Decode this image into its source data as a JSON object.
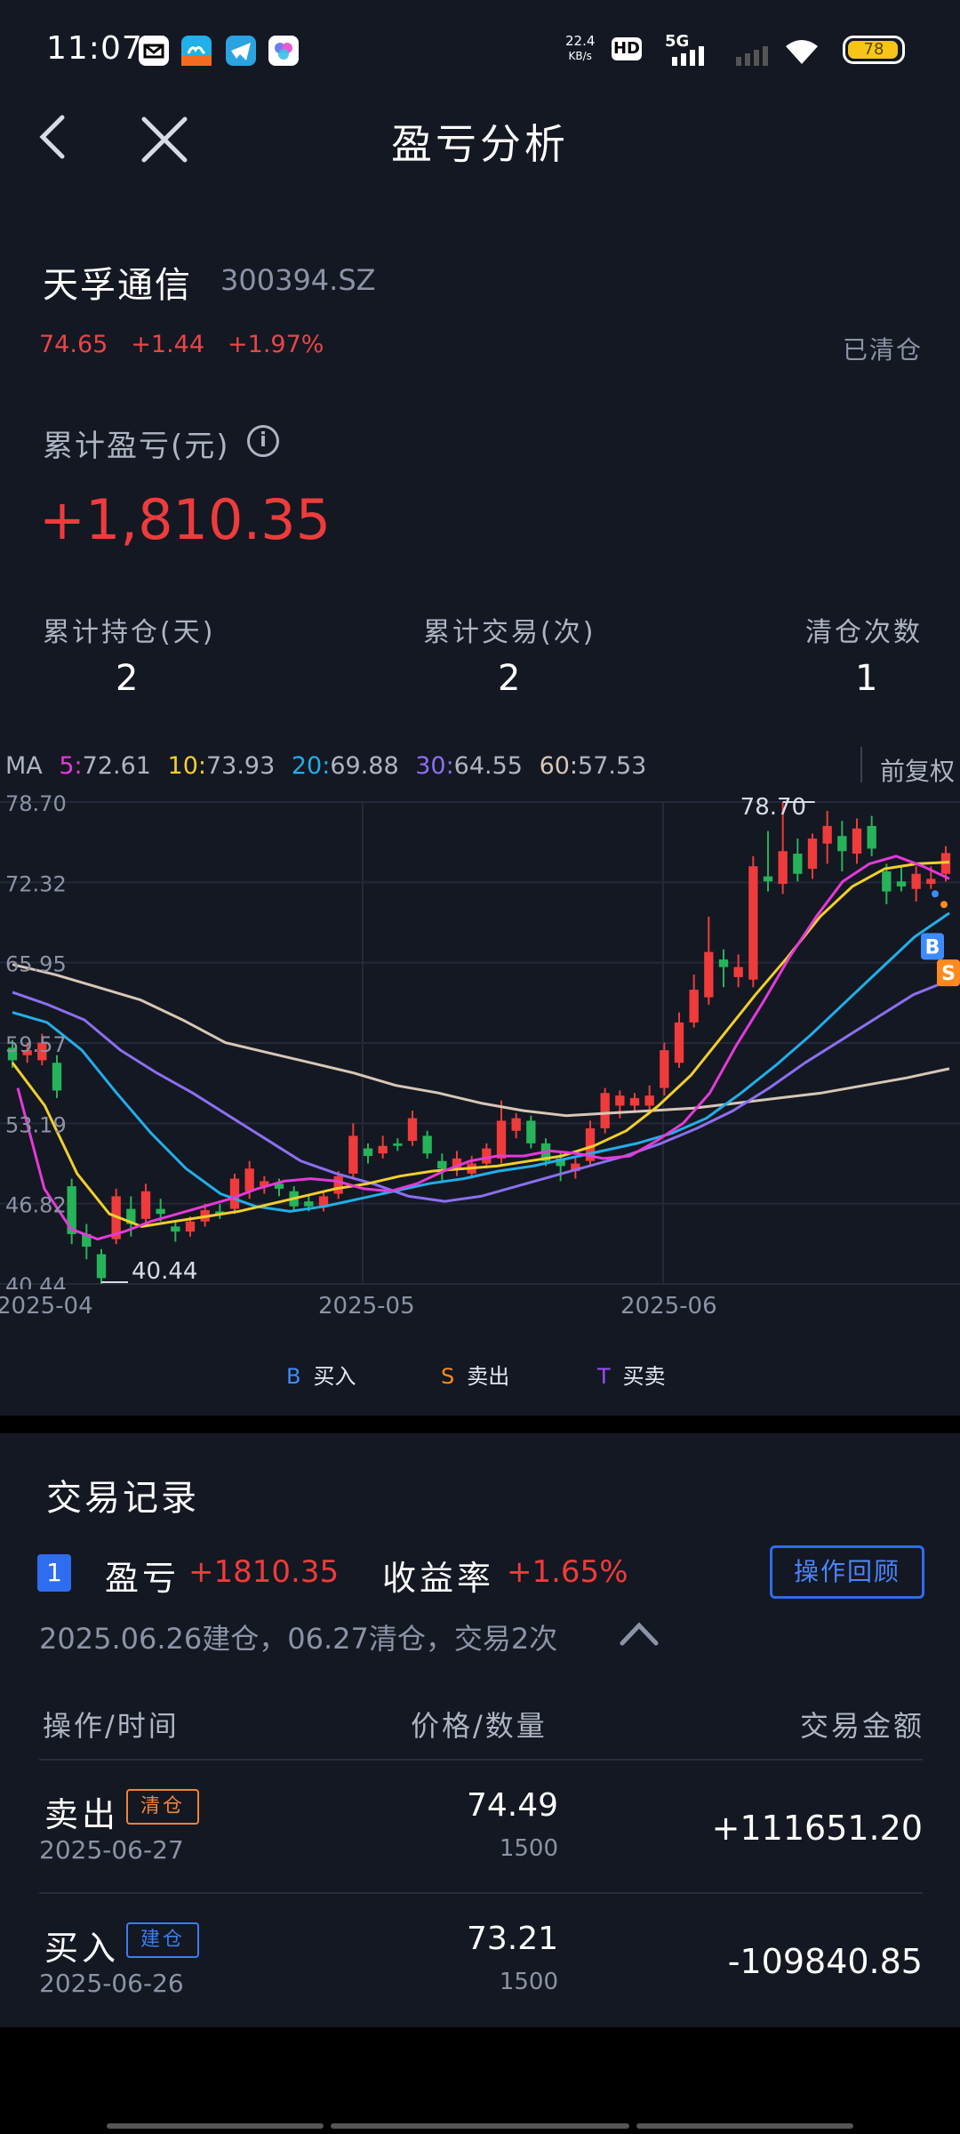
{
  "status_bar": {
    "time": "11:07",
    "net_speed_value": "22.4",
    "net_speed_unit": "KB/s",
    "hd": "HD",
    "network": "5G",
    "battery": "78",
    "app_icons": [
      "mail-app-icon",
      "camel-app-icon",
      "telegram-app-icon",
      "bubble-app-icon"
    ]
  },
  "header": {
    "title": "盈亏分析"
  },
  "stock": {
    "name": "天孚通信",
    "code": "300394.SZ",
    "price": "74.65",
    "change": "+1.44",
    "change_pct": "+1.97%",
    "status": "已清仓"
  },
  "cumulative": {
    "label": "累计盈亏(元)",
    "value": "+1,810.35"
  },
  "stats": [
    {
      "label": "累计持仓(天)",
      "value": "2"
    },
    {
      "label": "累计交易(次)",
      "value": "2"
    },
    {
      "label": "清仓次数",
      "value": "1"
    }
  ],
  "ma": {
    "prefix": "MA",
    "items": [
      {
        "key": "5:",
        "value": "72.61",
        "color": "#e43ad8"
      },
      {
        "key": "10:",
        "value": "73.93",
        "color": "#f1cf2c"
      },
      {
        "key": "20:",
        "value": "69.88",
        "color": "#22aee8"
      },
      {
        "key": "30:",
        "value": "64.55",
        "color": "#8b6ff0"
      },
      {
        "key": "60:",
        "value": "57.53",
        "color": "#d7c7b6"
      }
    ],
    "adjust": "前复权"
  },
  "chart_data": {
    "type": "candlestick",
    "y_ticks": [
      "78.70",
      "72.32",
      "65.95",
      "59.57",
      "53.19",
      "46.82",
      "40.44"
    ],
    "ylim": [
      40.44,
      78.7
    ],
    "x_ticks": [
      "2025-04",
      "2025-05",
      "2025-06"
    ],
    "high_label": "78.70",
    "low_label": "40.44",
    "candles": [
      {
        "o": 59.2,
        "c": 58.2,
        "h": 59.8,
        "l": 57.6
      },
      {
        "o": 58.6,
        "c": 59.0,
        "h": 59.6,
        "l": 58.0
      },
      {
        "o": 58.2,
        "c": 59.6,
        "h": 60.3,
        "l": 57.8
      },
      {
        "o": 58.0,
        "c": 55.8,
        "h": 58.6,
        "l": 55.2
      },
      {
        "o": 48.2,
        "c": 44.4,
        "h": 48.8,
        "l": 43.6
      },
      {
        "o": 44.4,
        "c": 43.4,
        "h": 45.2,
        "l": 42.4
      },
      {
        "o": 42.8,
        "c": 40.9,
        "h": 43.2,
        "l": 40.44
      },
      {
        "o": 44.0,
        "c": 47.4,
        "h": 48.0,
        "l": 43.6
      },
      {
        "o": 46.4,
        "c": 45.2,
        "h": 47.4,
        "l": 44.2
      },
      {
        "o": 45.6,
        "c": 47.8,
        "h": 48.4,
        "l": 45.0
      },
      {
        "o": 46.4,
        "c": 46.0,
        "h": 47.2,
        "l": 45.4
      },
      {
        "o": 45.0,
        "c": 44.6,
        "h": 45.4,
        "l": 43.8
      },
      {
        "o": 44.6,
        "c": 45.4,
        "h": 45.8,
        "l": 44.2
      },
      {
        "o": 45.4,
        "c": 46.3,
        "h": 46.8,
        "l": 45.0
      },
      {
        "o": 46.2,
        "c": 46.0,
        "h": 46.8,
        "l": 45.6
      },
      {
        "o": 46.4,
        "c": 48.8,
        "h": 49.2,
        "l": 46.0
      },
      {
        "o": 47.8,
        "c": 49.6,
        "h": 50.2,
        "l": 47.2
      },
      {
        "o": 48.2,
        "c": 48.6,
        "h": 49.0,
        "l": 47.6
      },
      {
        "o": 48.4,
        "c": 48.0,
        "h": 48.8,
        "l": 47.4
      },
      {
        "o": 47.8,
        "c": 46.6,
        "h": 48.2,
        "l": 46.2
      },
      {
        "o": 47.0,
        "c": 46.6,
        "h": 47.4,
        "l": 46.2
      },
      {
        "o": 46.6,
        "c": 47.4,
        "h": 47.8,
        "l": 46.2
      },
      {
        "o": 47.6,
        "c": 49.0,
        "h": 49.4,
        "l": 47.2
      },
      {
        "o": 49.2,
        "c": 52.2,
        "h": 53.2,
        "l": 48.8
      },
      {
        "o": 51.2,
        "c": 50.6,
        "h": 51.6,
        "l": 50.0
      },
      {
        "o": 50.8,
        "c": 51.4,
        "h": 52.2,
        "l": 50.4
      },
      {
        "o": 51.6,
        "c": 51.4,
        "h": 52.0,
        "l": 51.0
      },
      {
        "o": 51.8,
        "c": 53.6,
        "h": 54.2,
        "l": 51.4
      },
      {
        "o": 52.2,
        "c": 50.8,
        "h": 52.6,
        "l": 50.4
      },
      {
        "o": 50.2,
        "c": 49.6,
        "h": 50.8,
        "l": 48.6
      },
      {
        "o": 49.6,
        "c": 50.4,
        "h": 51.0,
        "l": 49.0
      },
      {
        "o": 49.2,
        "c": 50.0,
        "h": 50.6,
        "l": 48.8
      },
      {
        "o": 50.0,
        "c": 51.2,
        "h": 51.6,
        "l": 49.6
      },
      {
        "o": 50.4,
        "c": 53.4,
        "h": 55.0,
        "l": 50.0
      },
      {
        "o": 52.6,
        "c": 53.6,
        "h": 54.0,
        "l": 52.0
      },
      {
        "o": 53.4,
        "c": 51.6,
        "h": 53.8,
        "l": 51.2
      },
      {
        "o": 51.6,
        "c": 50.2,
        "h": 52.0,
        "l": 49.8
      },
      {
        "o": 50.4,
        "c": 49.8,
        "h": 51.0,
        "l": 48.6
      },
      {
        "o": 49.4,
        "c": 50.0,
        "h": 50.6,
        "l": 48.8
      },
      {
        "o": 50.2,
        "c": 52.8,
        "h": 53.4,
        "l": 49.8
      },
      {
        "o": 52.8,
        "c": 55.6,
        "h": 56.0,
        "l": 52.4
      },
      {
        "o": 54.6,
        "c": 55.4,
        "h": 55.8,
        "l": 53.6
      },
      {
        "o": 54.6,
        "c": 55.2,
        "h": 55.6,
        "l": 54.2
      },
      {
        "o": 54.6,
        "c": 55.4,
        "h": 56.2,
        "l": 54.2
      },
      {
        "o": 56.0,
        "c": 59.0,
        "h": 59.6,
        "l": 55.4
      },
      {
        "o": 58.0,
        "c": 61.2,
        "h": 62.0,
        "l": 57.6
      },
      {
        "o": 61.2,
        "c": 63.8,
        "h": 65.0,
        "l": 60.8
      },
      {
        "o": 63.2,
        "c": 66.8,
        "h": 69.6,
        "l": 62.6
      },
      {
        "o": 66.2,
        "c": 65.6,
        "h": 67.0,
        "l": 64.0
      },
      {
        "o": 64.8,
        "c": 65.6,
        "h": 66.6,
        "l": 64.0
      },
      {
        "o": 64.6,
        "c": 73.6,
        "h": 74.4,
        "l": 64.0
      },
      {
        "o": 72.8,
        "c": 72.4,
        "h": 76.4,
        "l": 71.6
      },
      {
        "o": 72.2,
        "c": 74.8,
        "h": 78.7,
        "l": 71.4
      },
      {
        "o": 74.6,
        "c": 73.0,
        "h": 75.8,
        "l": 72.4
      },
      {
        "o": 73.4,
        "c": 75.8,
        "h": 76.2,
        "l": 72.6
      },
      {
        "o": 75.4,
        "c": 76.8,
        "h": 78.0,
        "l": 73.8
      },
      {
        "o": 76.0,
        "c": 74.8,
        "h": 77.2,
        "l": 73.2
      },
      {
        "o": 74.6,
        "c": 76.6,
        "h": 77.4,
        "l": 73.8
      },
      {
        "o": 76.8,
        "c": 75.0,
        "h": 77.6,
        "l": 74.4
      },
      {
        "o": 73.2,
        "c": 71.6,
        "h": 73.8,
        "l": 70.6
      },
      {
        "o": 72.4,
        "c": 72.0,
        "h": 73.6,
        "l": 71.6
      },
      {
        "o": 71.8,
        "c": 73.0,
        "h": 73.6,
        "l": 70.8
      },
      {
        "o": 72.2,
        "c": 72.6,
        "h": 73.6,
        "l": 71.8
      },
      {
        "o": 73.0,
        "c": 74.65,
        "h": 75.2,
        "l": 72.4
      }
    ],
    "ma5": [
      56.0,
      48.0,
      44.8,
      44.0,
      44.6,
      45.4,
      46.0,
      46.6,
      47.2,
      48.0,
      48.6,
      48.8,
      48.6,
      48.0,
      47.8,
      48.4,
      49.4,
      50.2,
      50.6,
      50.6,
      51.0,
      50.8,
      50.4,
      50.6,
      51.8,
      53.2,
      55.6,
      59.4,
      62.8,
      66.4,
      69.6,
      72.4,
      73.8,
      74.4,
      73.6,
      72.61
    ],
    "ma10": [
      58.0,
      54.6,
      49.2,
      46.0,
      45.0,
      45.4,
      45.8,
      46.2,
      46.8,
      47.4,
      48.0,
      48.4,
      49.0,
      49.4,
      49.6,
      49.8,
      50.2,
      50.6,
      51.4,
      52.6,
      54.6,
      57.0,
      60.2,
      63.4,
      66.4,
      69.6,
      72.0,
      73.4,
      73.8,
      73.93
    ],
    "ma20": [
      62.0,
      61.2,
      59.0,
      55.6,
      52.4,
      49.6,
      47.6,
      46.6,
      46.2,
      46.6,
      47.2,
      47.8,
      48.4,
      48.8,
      49.4,
      49.8,
      50.4,
      51.0,
      51.6,
      52.4,
      53.6,
      55.6,
      57.8,
      60.2,
      62.8,
      65.4,
      68.0,
      69.88
    ],
    "ma30": [
      63.6,
      62.6,
      61.4,
      59.0,
      57.2,
      55.6,
      53.8,
      52.0,
      50.2,
      49.2,
      48.4,
      47.4,
      47.0,
      47.4,
      48.2,
      49.0,
      49.8,
      50.6,
      51.6,
      52.8,
      54.2,
      56.0,
      58.0,
      59.8,
      61.6,
      63.4,
      64.55
    ],
    "ma60": [
      65.8,
      65.0,
      64.0,
      63.0,
      61.4,
      59.6,
      58.8,
      58.0,
      57.2,
      56.2,
      55.6,
      54.8,
      54.2,
      53.8,
      54.0,
      54.2,
      54.4,
      54.8,
      55.2,
      55.6,
      56.2,
      56.8,
      57.53
    ],
    "trade_markers": [
      "B",
      "S"
    ]
  },
  "legend": [
    {
      "key": "B",
      "label": "买入",
      "color": "#3d8bff"
    },
    {
      "key": "S",
      "label": "卖出",
      "color": "#ff8a1f"
    },
    {
      "key": "T",
      "label": "买卖",
      "color": "#9a4bff"
    }
  ],
  "records": {
    "title": "交易记录",
    "index": "1",
    "pl_label": "盈亏",
    "pl_value": "+1810.35",
    "ret_label": "收益率",
    "ret_value": "+1.65%",
    "review_button": "操作回顾",
    "summary": "2025.06.26建仓，06.27清仓，交易2次",
    "columns": [
      "操作/时间",
      "价格/数量",
      "交易金额"
    ],
    "rows": [
      {
        "op": "卖出",
        "tag": "清仓",
        "tag_color": "#f0843c",
        "date": "2025-06-27",
        "price": "74.49",
        "qty": "1500",
        "amount": "+111651.20"
      },
      {
        "op": "买入",
        "tag": "建仓",
        "tag_color": "#3d7cf0",
        "date": "2025-06-26",
        "price": "73.21",
        "qty": "1500",
        "amount": "-109840.85"
      }
    ]
  }
}
